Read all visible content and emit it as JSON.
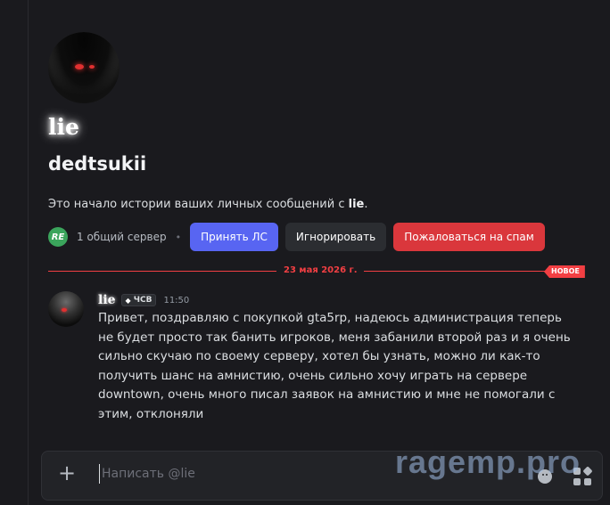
{
  "profile": {
    "display_name": "lie",
    "username": "dedtsukii",
    "intro_prefix": "Это начало истории ваших личных сообщений с ",
    "intro_name": "lie",
    "intro_suffix": "."
  },
  "mutual": {
    "server_icon_text": "RE",
    "server_count": "1 общий сервер"
  },
  "actions": {
    "accept": "Принять ЛС",
    "ignore": "Игнорировать",
    "spam": "Пожаловаться на спам"
  },
  "divider": {
    "date": "23 мая 2026 г.",
    "new_label": "НОВОЕ"
  },
  "message": {
    "author": "lie",
    "tag": "ЧСВ",
    "time": "11:50",
    "text": "Привет, поздравляю с покупкой gta5rp, надеюсь администрация теперь не будет просто так банить игроков, меня забанили второй раз и я очень сильно скучаю по своему серверу, хотел бы узнать, можно ли как-то получить шанс на амнистию, очень сильно хочу играть на сервере downtown, очень много писал заявок на амнистию и мне не помогали с этим, отклоняли"
  },
  "composer": {
    "placeholder": "Написать @lie",
    "attach_icon": "plus-icon",
    "emoji_icon": "emoji-icon",
    "apps_icon": "apps-icon"
  },
  "watermark": "ragemp.pro",
  "colors": {
    "background": "#1a1a1e",
    "accept": "#5865f2",
    "spam": "#da373c",
    "new_divider": "#f23f43"
  }
}
